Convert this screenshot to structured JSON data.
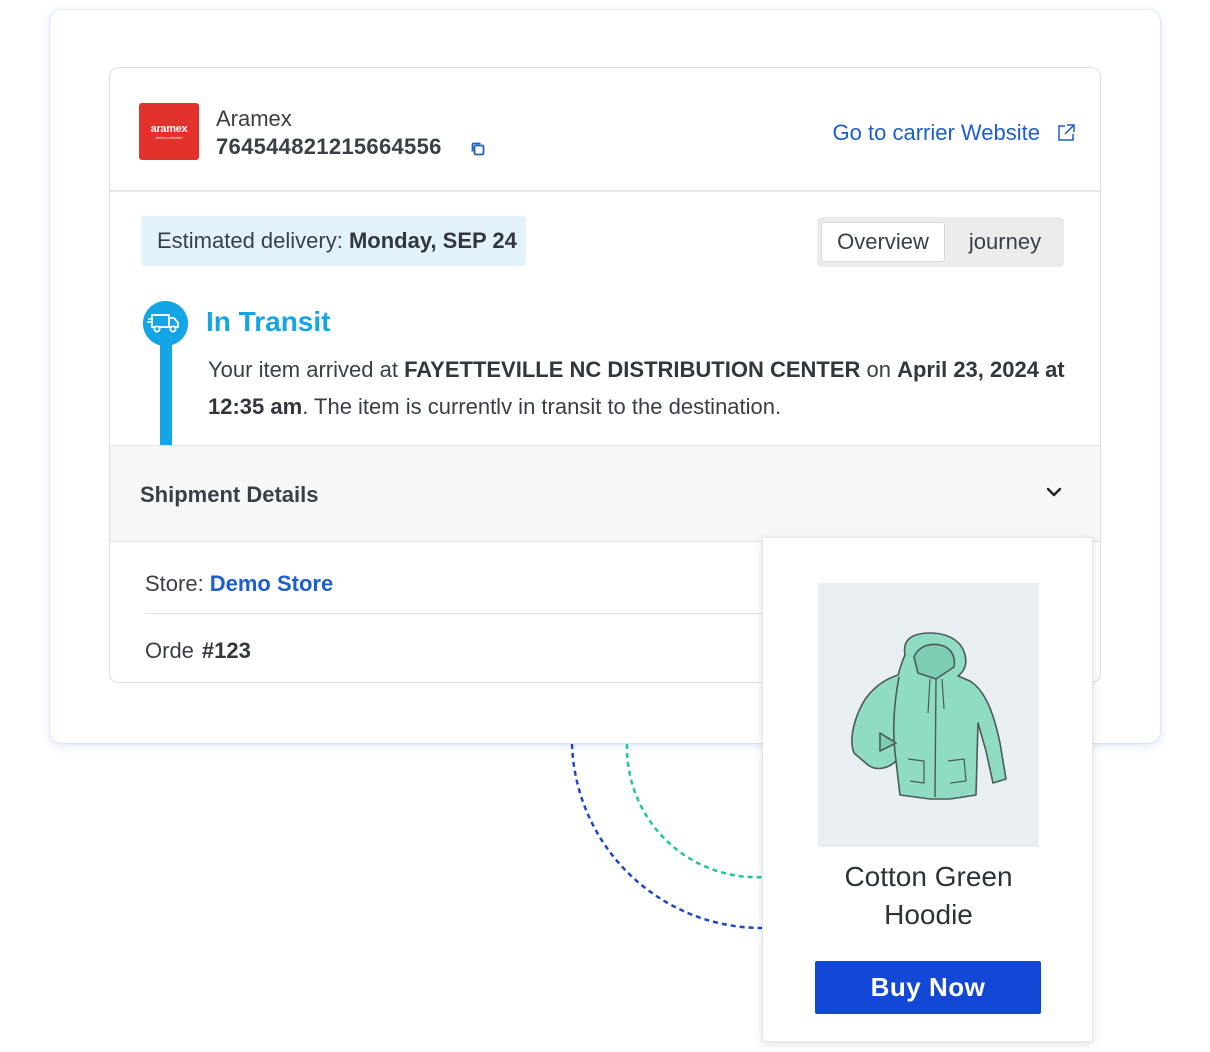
{
  "carrier": {
    "logo_text": "aramex",
    "logo_subtext": "delivery unlimited",
    "name": "Aramex",
    "tracking_number": "764544821215664556",
    "website_link": "Go to carrier Website",
    "brand_color": "#e3312c"
  },
  "delivery": {
    "label": "Estimated delivery: ",
    "date": "Monday, SEP 24"
  },
  "tabs": [
    {
      "label": "Overview",
      "active": true
    },
    {
      "label": "journey",
      "active": false
    }
  ],
  "status": {
    "title": "In Transit",
    "msg_prefix": "Your item arrived at ",
    "location": "FAYETTEVILLE NC DISTRIBUTION CENTER",
    "msg_on": " on ",
    "datetime": "April 23, 2024 at 12:35 am",
    "msg_suffix": ". The item is currentlv in transit to the destination.",
    "color": "#14a5e6",
    "icon": "truck-icon"
  },
  "shipment_details": {
    "title": "Shipment Details",
    "store_label": "Store:",
    "store_value": "Demo Store",
    "order_label": "Orde",
    "order_value": "#123"
  },
  "product": {
    "name": "Cotton Green Hoodie",
    "button": "Buy Now",
    "button_color": "#1347d6",
    "image": "hoodie-image"
  },
  "icons": [
    "copy-icon",
    "external-link-icon",
    "truck-icon",
    "chevron-down-icon"
  ]
}
